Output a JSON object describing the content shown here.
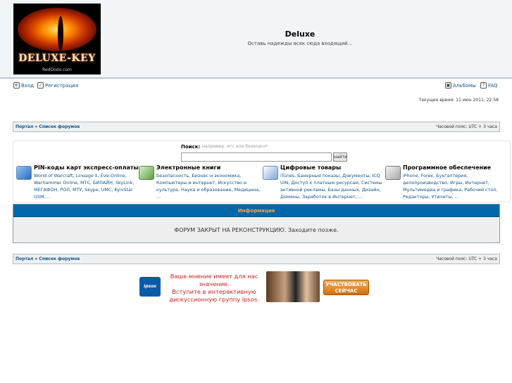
{
  "header": {
    "logo_text": "DELUXE-KEY",
    "logo_sub": "RedDodo.com",
    "site_title": "Deluxe",
    "site_desc": "Оставь надежды всяк сюда входящий..."
  },
  "nav": {
    "login": "Вход",
    "register": "Регистрация",
    "albums": "Альбомы",
    "faq": "FAQ"
  },
  "time_text": "Текущее время: 11 июн 2011, 22:58",
  "breadcrumb": {
    "portal": "Портал",
    "sep": " » ",
    "forums": "Список форумов",
    "timezone": "Часовой пояс: UTC + 3 часа"
  },
  "search": {
    "label": "Поиск:",
    "hint": "например: итс или безопасн*",
    "value": "",
    "button": "найти"
  },
  "categories": [
    {
      "title": "PIN-коды карт экспресс-оплаты",
      "icon": "pin-card-icon",
      "links": "World of Warcraft, Lineage II, Eve-Online, Warhammer Online, МТС, БИЛАЙН, SkyLink, МЕГАФОН, РОЛ, МТУ, Skype, UMC, KyivStar GSM, ..."
    },
    {
      "title": "Электронные книги",
      "icon": "ebook-icon",
      "links": "Безопасность, Бизнес и экономика, Компьютеры и интернет, Искусство и культура, Наука и образование, Медицина, ..."
    },
    {
      "title": "Цифровые товары",
      "icon": "digital-goods-icon",
      "links": "iTunes, Банерные показы, Документы, ICQ UIN, Доступ к платным ресурсам, Системы активной рекламы, Базы данных, Дизайн, Домены, Заработок в Интернет, ..."
    },
    {
      "title": "Программное обеспечение",
      "icon": "software-icon",
      "links": "iPhone, Forex, Бухгалтерия, делопроизводство, Игры, Интернет, Мультимедиа и графика, Рабочий стол, Редакторы, Утилиты, ..."
    }
  ],
  "info": {
    "title": "Информация",
    "message": "ФОРУМ ЗАКРЫТ НА РЕКОНСТРУКЦИЮ. Заходите позже."
  },
  "ad": {
    "brand": "Ipsos",
    "line1": "Ваше мнение имеет для нас",
    "line2": "значение.",
    "line3": "Вступите в интерактивную",
    "line4": "дискуссионную группу Ipsos.",
    "button_line1": "УЧАСТВОВАТЬ",
    "button_line2": "СЕЙЧАС"
  },
  "colors": {
    "info_header": "#0068a8",
    "info_title": "#ffa34f",
    "link": "#105289",
    "ad_text": "#c81e1e"
  }
}
